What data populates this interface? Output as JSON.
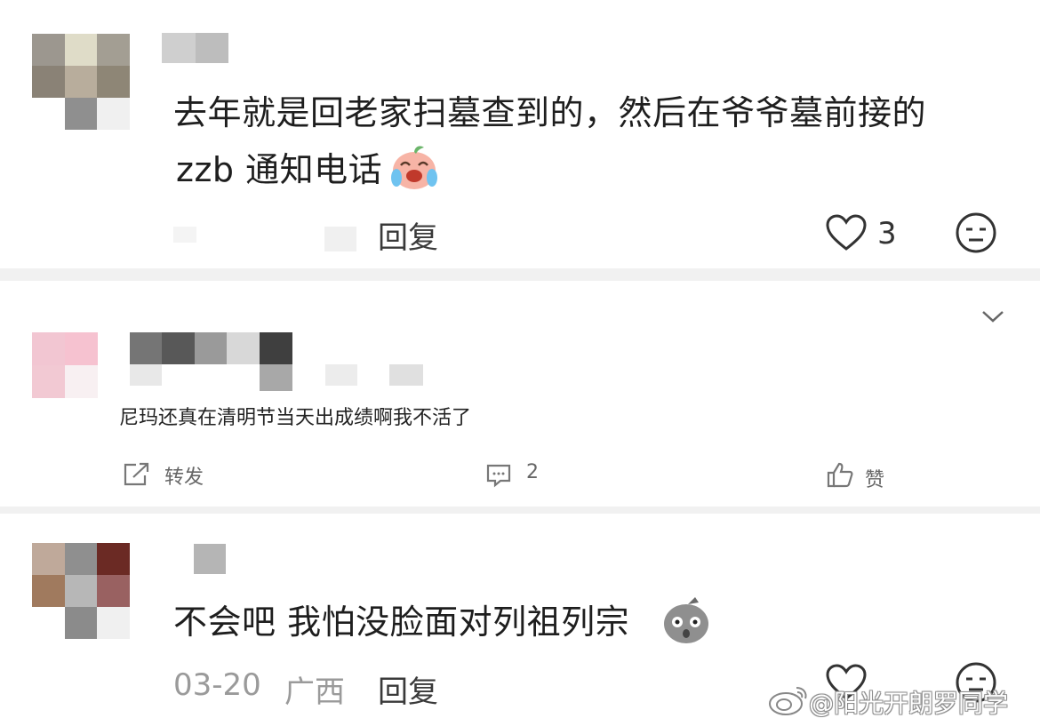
{
  "comments": [
    {
      "text_line1": "去年就是回老家扫墓查到的，然后在爷爷墓前接的",
      "text_line2": "zzb 通知电话",
      "reply_label": "回复",
      "like_count": "3",
      "emoji_icon": "crying-laughing-peach-emoji"
    },
    {
      "date": "03-20",
      "location": "广西",
      "text": "不会吧 我怕没脸面对列祖列宗",
      "reply_label": "回复",
      "emoji_icon": "shocked-face-emoji"
    }
  ],
  "weibo_post": {
    "text": "尼玛还真在清明节当天出成绩啊我不活了",
    "repost_label": "转发",
    "comment_count": "2",
    "like_label": "赞"
  },
  "watermark": "@阳光开朗罗同学",
  "icons": [
    "heart-icon",
    "neutral-face-icon",
    "chevron-down-icon",
    "repost-icon",
    "comment-icon",
    "thumbs-up-icon",
    "weibo-logo-icon"
  ],
  "colors": {
    "background": "#f1f1f1",
    "card": "#ffffff",
    "text": "#1e1e1e",
    "meta": "#9a9a9a"
  }
}
